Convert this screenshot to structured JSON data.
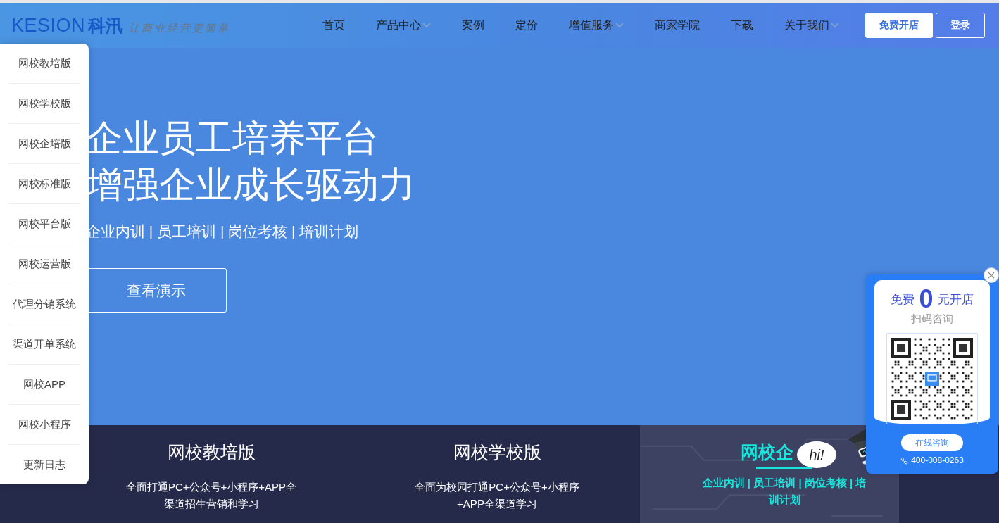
{
  "logo": {
    "brand": "KESION",
    "brand_cn": "科汛",
    "slogan": "让商业经营更简单"
  },
  "nav": [
    {
      "label": "首页",
      "dropdown": false
    },
    {
      "label": "产品中心",
      "dropdown": true
    },
    {
      "label": "案例",
      "dropdown": false
    },
    {
      "label": "定价",
      "dropdown": false
    },
    {
      "label": "增值服务",
      "dropdown": true
    },
    {
      "label": "商家学院",
      "dropdown": false
    },
    {
      "label": "下载",
      "dropdown": false
    },
    {
      "label": "关于我们",
      "dropdown": true
    }
  ],
  "header_buttons": [
    {
      "label": "免费开店",
      "kind": "primary"
    },
    {
      "label": "登录",
      "kind": "outline"
    }
  ],
  "side_menu": [
    "网校教培版",
    "网校学校版",
    "网校企培版",
    "网校标准版",
    "网校平台版",
    "网校运营版",
    "代理分销系统",
    "渠道开单系统",
    "网校APP",
    "网校小程序",
    "更新日志"
  ],
  "hero": {
    "title_lines": [
      "企业员工培养平台",
      "增强企业成长驱动力"
    ],
    "tags": "企业内训 | 员工培训 | 岗位考核 | 培训计划",
    "button": "查看演示"
  },
  "product_cards": [
    {
      "title": "网校教培版",
      "description": "全面打通PC+公众号+小程序+APP全渠道招生营销和学习",
      "selected": false
    },
    {
      "title": "网校学校版",
      "description": "全面为校园打通PC+公众号+小程序+APP全渠道学习",
      "selected": false
    },
    {
      "title": "网校企",
      "description": "企业内训 | 员工培训 | 岗位考核 | 培训计划",
      "selected": true
    }
  ],
  "mascot": {
    "bubble": "hi!"
  },
  "qr_widget": {
    "prefix": "免费",
    "number": "0",
    "suffix": "元开店",
    "subtitle": "扫码咨询",
    "button": "在线咨询",
    "phone": "400-008-0263"
  }
}
